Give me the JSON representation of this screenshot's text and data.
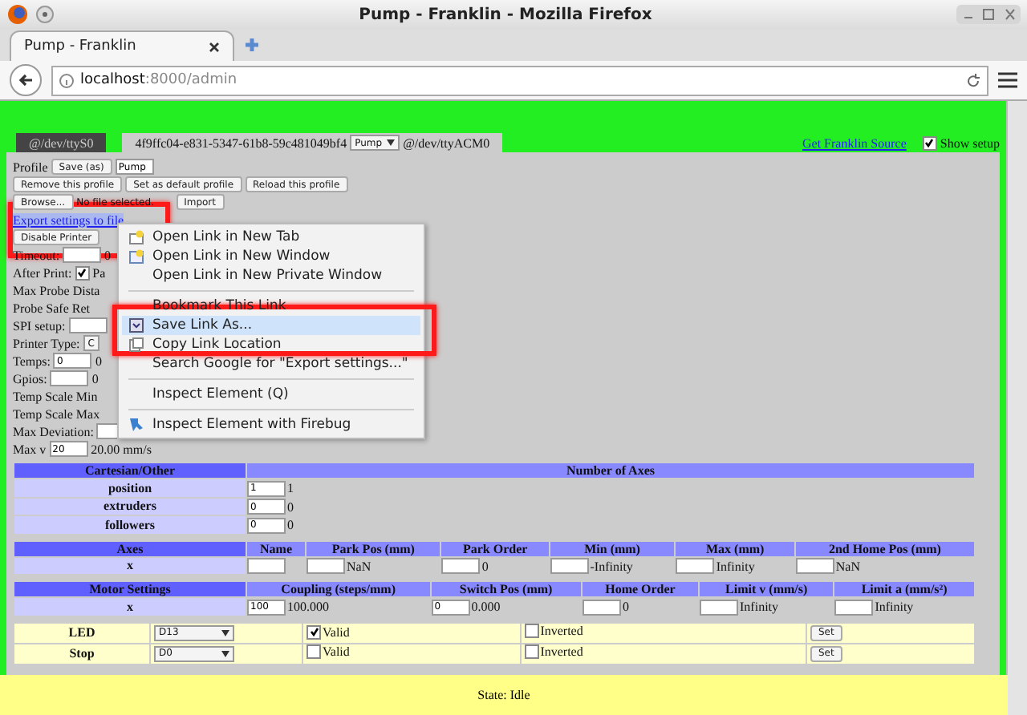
{
  "window": {
    "title": "Pump - Franklin - Mozilla Firefox"
  },
  "browser_tabs": [
    {
      "label": "Pump - Franklin",
      "selected": true
    }
  ],
  "url": {
    "host": "localhost",
    "path": ":8000/admin"
  },
  "device_tabs": [
    {
      "label": "@/dev/ttyS0",
      "selected": false
    },
    {
      "label": "4f9ffc04-e831-5347-61b8-59c481049bf4",
      "selected": true,
      "select": "Pump",
      "suffix": "@/dev/ttyACM0"
    }
  ],
  "source_link": "Get Franklin Source",
  "show_setup": {
    "label": "Show setup",
    "checked": true
  },
  "profile": {
    "label": "Profile",
    "save_button": "Save (as)",
    "name": "Pump",
    "buttons": [
      "Remove this profile",
      "Set as default profile",
      "Reload this profile"
    ],
    "browse": "Browse...",
    "file": "No file selected.",
    "import": "Import",
    "export_link": "Export settings to file",
    "disable": "Disable Printer"
  },
  "settings": [
    {
      "label": "Timeout:",
      "kind": "input",
      "text": "0"
    },
    {
      "label": "After Print:",
      "kind": "checkbox",
      "checked": true,
      "text": "Pa"
    },
    {
      "label": "Max Probe Dista",
      "kind": "text"
    },
    {
      "label": "Probe Safe Ret",
      "kind": "text"
    },
    {
      "label": "SPI setup:",
      "kind": "input"
    },
    {
      "label": "Printer Type:",
      "kind": "select",
      "value": "C"
    },
    {
      "label": "Temps:",
      "kind": "input",
      "value": "0",
      "text": "0"
    },
    {
      "label": "Gpios:",
      "kind": "input",
      "text": "0"
    },
    {
      "label": "Temp Scale Min",
      "kind": "text"
    },
    {
      "label": "Temp Scale Max",
      "kind": "text"
    },
    {
      "label": "Max Deviation:",
      "kind": "input"
    },
    {
      "label": "Max v",
      "kind": "input",
      "value": "20",
      "text": "20.00 mm/s"
    }
  ],
  "cartesian": {
    "columns": [
      "Cartesian/Other",
      "Number of Axes"
    ],
    "rows": [
      {
        "cells": [
          {
            "text": "position"
          },
          {
            "value": "1",
            "text": "1"
          }
        ]
      },
      {
        "cells": [
          {
            "text": "extruders"
          },
          {
            "value": "0",
            "text": "0"
          }
        ]
      },
      {
        "cells": [
          {
            "text": "followers"
          },
          {
            "value": "0",
            "text": "0"
          }
        ]
      }
    ]
  },
  "axes": {
    "columns": [
      "Axes",
      "Name",
      "Park Pos (mm)",
      "Park Order",
      "Min (mm)",
      "Max (mm)",
      "2nd Home Pos (mm)"
    ],
    "rows": [
      {
        "cells": [
          {
            "text": "x"
          },
          {},
          {
            "text": "NaN"
          },
          {
            "text": "0"
          },
          {
            "text": "-Infinity"
          },
          {
            "text": "Infinity"
          },
          {
            "text": "NaN"
          }
        ]
      }
    ]
  },
  "motors": {
    "columns": [
      "Motor Settings",
      "Coupling (steps/mm)",
      "Switch Pos (mm)",
      "Home Order",
      "Limit v (mm/s)",
      "Limit a (mm/s²)"
    ],
    "rows": [
      {
        "cells": [
          {
            "text": "x"
          },
          {
            "value": "100",
            "text": "100.000"
          },
          {
            "value": "0",
            "text": "0.000"
          },
          {
            "text": "0"
          },
          {
            "text": "Infinity"
          },
          {
            "text": "Infinity"
          }
        ]
      }
    ]
  },
  "gpios": [
    {
      "label": "LED",
      "pin": "D13",
      "valid_label": "Valid",
      "valid": true,
      "inverted_label": "Inverted",
      "inverted": false,
      "button": "Set"
    },
    {
      "label": "Stop",
      "pin": "D0",
      "valid_label": "Valid",
      "valid": false,
      "inverted_label": "Inverted",
      "inverted": false,
      "button": "Set"
    }
  ],
  "status_bar": "State: Idle",
  "context_menu": [
    {
      "kind": "item",
      "label": "Open Link in New Tab",
      "selected": false
    },
    {
      "kind": "item",
      "label": "Open Link in New Window",
      "selected": false
    },
    {
      "kind": "item",
      "label": "Open Link in New Private Window",
      "selected": false
    },
    {
      "kind": "separator"
    },
    {
      "kind": "item",
      "label": "Bookmark This Link",
      "selected": false
    },
    {
      "kind": "item",
      "label": "Save Link As...",
      "selected": true
    },
    {
      "kind": "item",
      "label": "Copy Link Location",
      "selected": false
    },
    {
      "kind": "item",
      "label": "Search Google for \"Export settings...\"",
      "selected": false
    },
    {
      "kind": "separator"
    },
    {
      "kind": "item",
      "label": "Inspect Element (Q)",
      "selected": false
    },
    {
      "kind": "separator"
    },
    {
      "kind": "item",
      "label": "Inspect Element with Firebug",
      "selected": false
    }
  ]
}
